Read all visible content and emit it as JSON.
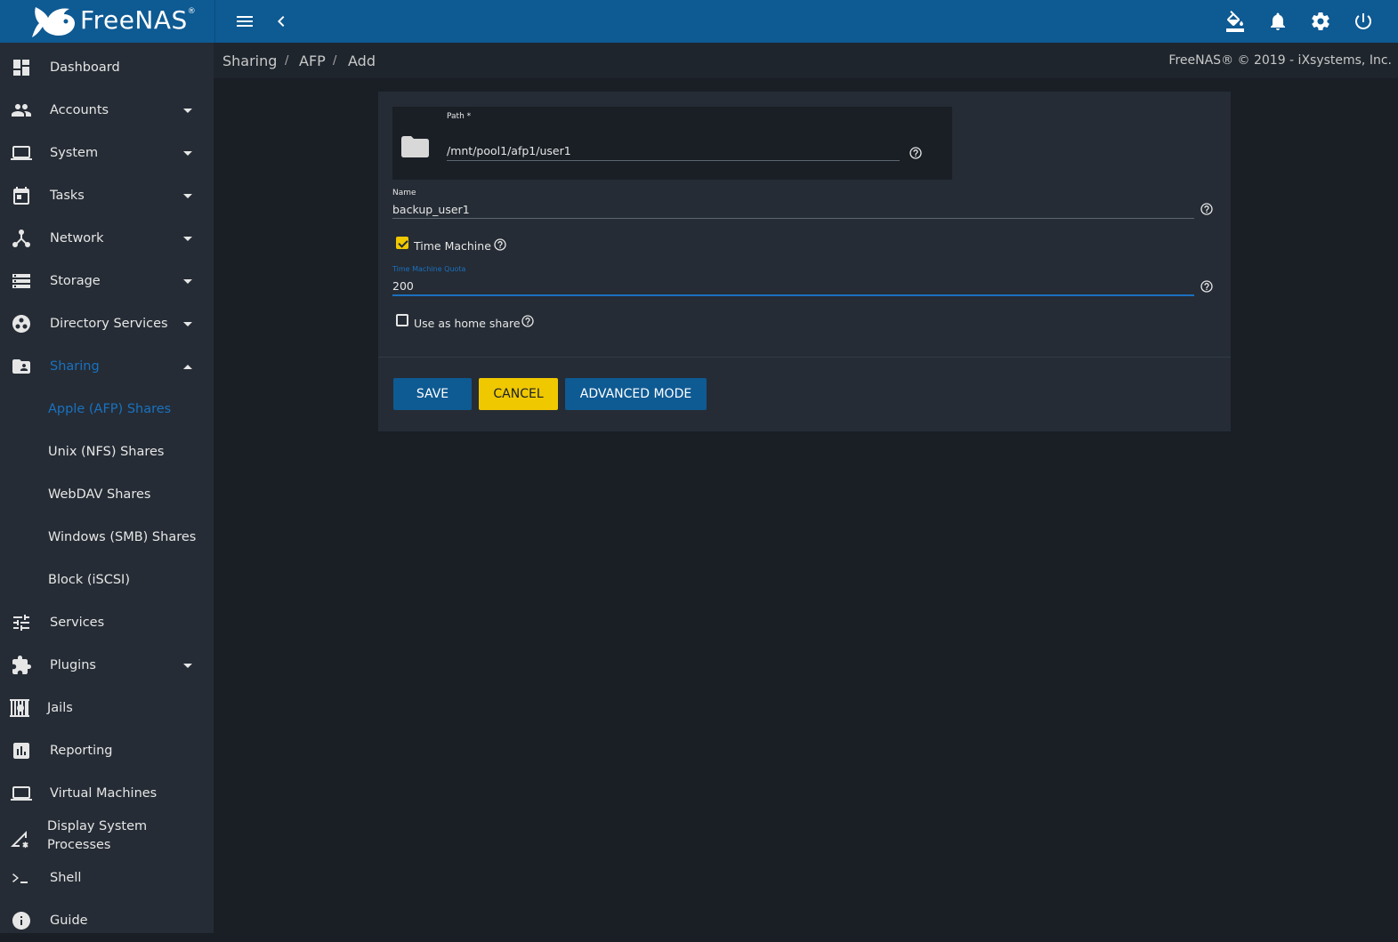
{
  "app": {
    "logo_text": "FreeNAS",
    "logo_mark": "®",
    "copyright": "FreeNAS® © 2019 - iXsystems, Inc."
  },
  "topbar": {
    "icons": [
      "menu-icon",
      "chevron-left-icon",
      "theme-paint-icon",
      "bell-icon",
      "gear-icon",
      "power-icon"
    ]
  },
  "breadcrumb": [
    "Sharing",
    "AFP",
    "Add"
  ],
  "breadcrumb_sep": "/",
  "sidebar": {
    "items": [
      {
        "label": "Dashboard",
        "icon": "dashboard-icon"
      },
      {
        "label": "Accounts",
        "icon": "accounts-icon"
      },
      {
        "label": "System",
        "icon": "laptop-icon"
      },
      {
        "label": "Tasks",
        "icon": "calendar-icon"
      },
      {
        "label": "Network",
        "icon": "network-icon"
      },
      {
        "label": "Storage",
        "icon": "storage-icon"
      },
      {
        "label": "Directory Services",
        "icon": "directory-icon"
      },
      {
        "label": "Sharing",
        "icon": "shared-folder-icon"
      },
      {
        "label": "Services",
        "icon": "tune-icon"
      },
      {
        "label": "Plugins",
        "icon": "puzzle-icon"
      },
      {
        "label": "Jails",
        "icon": "jail-icon"
      },
      {
        "label": "Reporting",
        "icon": "chart-icon"
      },
      {
        "label": "Virtual Machines",
        "icon": "laptop-icon"
      },
      {
        "label": "Display System Processes",
        "label_line1": "Display System",
        "label_line2": "Processes",
        "icon": "processes-icon"
      },
      {
        "label": "Shell",
        "icon": "terminal-icon"
      },
      {
        "label": "Guide",
        "icon": "info-icon"
      }
    ],
    "sharing_sub": [
      {
        "label": "Apple (AFP) Shares"
      },
      {
        "label": "Unix (NFS) Shares"
      },
      {
        "label": "WebDAV Shares"
      },
      {
        "label": "Windows (SMB) Shares"
      },
      {
        "label": "Block (iSCSI)"
      }
    ]
  },
  "form": {
    "path": {
      "label": "Path *",
      "value": "/mnt/pool1/afp1/user1"
    },
    "name": {
      "label": "Name",
      "value": "backup_user1"
    },
    "time_machine": {
      "label": "Time Machine",
      "checked": true
    },
    "time_machine_quota": {
      "label": "Time Machine Quota",
      "value": "200"
    },
    "home_share": {
      "label": "Use as home share",
      "checked": false
    }
  },
  "buttons": {
    "save": "SAVE",
    "cancel": "CANCEL",
    "advanced": "ADVANCED MODE"
  },
  "colors": {
    "topbar": "#0e5a93",
    "sidebar": "#252c35",
    "background": "#1a1f26",
    "accent": "#1a71c0",
    "warning": "#f0c800"
  }
}
